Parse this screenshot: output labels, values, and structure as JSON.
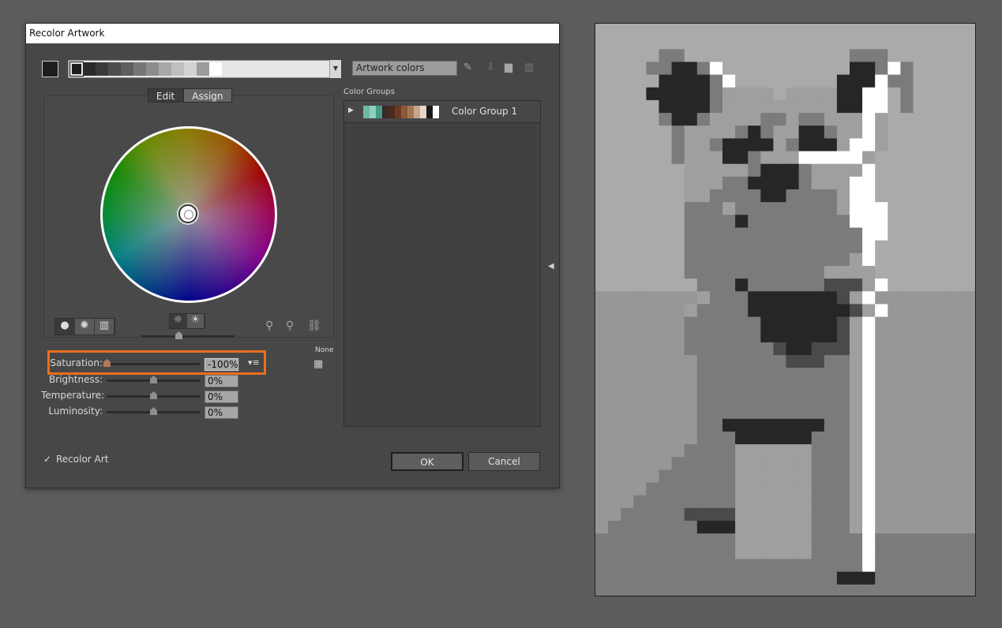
{
  "dialog": {
    "title": "Recolor Artwork",
    "artwork_colors_field": "Artwork colors",
    "strip_colors": [
      "#1e1e1e",
      "#2b2b2b",
      "#3a3a3a",
      "#4d4d4d",
      "#5e5e5e",
      "#767676",
      "#8d8d8d",
      "#a8a8a8",
      "#bfbfbf",
      "#d2d2d2",
      "#9c9c9c",
      "#ffffff"
    ],
    "tabs": [
      {
        "label": "Edit",
        "active": true
      },
      {
        "label": "Assign",
        "active": false
      }
    ],
    "color_groups_label": "Color Groups",
    "group": {
      "name": "Color Group 1",
      "colors": [
        "#6fb8a5",
        "#8ed0bf",
        "#4a9a86",
        "#3a2a24",
        "#4b2a1c",
        "#6b3a22",
        "#8a5a3a",
        "#a27555",
        "#c5a690",
        "#e8d6c8",
        "#1a1a1a",
        "#ffffff"
      ]
    },
    "none_label": "None",
    "sliders": [
      {
        "label": "Saturation:",
        "value": "-100%",
        "level": 0.0
      },
      {
        "label": "Brightness:",
        "value": "0%",
        "level": 0.5
      },
      {
        "label": "Temperature:",
        "value": "0%",
        "level": 0.5
      },
      {
        "label": "Luminosity:",
        "value": "0%",
        "level": 0.5
      }
    ],
    "recolor_art_label": "Recolor Art",
    "recolor_art_checked": true,
    "ok_label": "OK",
    "cancel_label": "Cancel",
    "highlight_color": "#e8701e"
  },
  "preview": {
    "grid_cols": 30,
    "grid_rows": 45,
    "pixels": [
      "ccccccccccccccccccccccccccccccc",
      "cccccccccccccccccccccccccccccc",
      "cccccmmcccccccccccccmmmccccccc",
      "ccccmmDDmWccccccccccDDmWmccccc",
      "cccccDDDDmWccccccccDDDWmmccccc",
      "ccccDDDDDmllllcllllDDWWcmccccc",
      "cccccDDDDmlllllllllDDWWcmccccc",
      "cccccmDDmllllmmlmmlllWlccccccc",
      "ccccccmllllmDmllDDmllWlccccccc",
      "ccccccmllmDDDDlmDDDlWWlccccccc",
      "ccccccmlllDDmlllWWWWWlcccccccc",
      "ccccccclllllmDDDmllllWcccccccc",
      "ccccccclllmmDDDDmlllWWcccccccc",
      "cccccccllmmmmDDmmmmlWWcccccccc",
      "cccccccmmmlmmmmmmmmlWWWccccccc",
      "cccccccmmmmDmmmmmmmmWWWccccccc",
      "cccccccmmmmmmmmmmmmmmWWccccccc",
      "cccccccmmmmmmmmmmmmmmWcccccccc",
      "cccccccmmmmmmmmmmmmmlWcccccccc",
      "cccccccmmmmmmmmmmmllllcccccccc",
      "ccccccccmmmDmmmmmmdddlWccccccc",
      "gggggggglmmmDDDDDDDdlWgggggggg",
      "ggggggglmmmmDDDDDDDDdlWggggggg",
      "gggggggmmmmmmDDDDDDdlWgggggggg",
      "gggggggmmmmmmDDDDDDdlWgggggggg",
      "gggggggmmmmmmmdDDdddlWgggggggg",
      "ggggggggmmmmmmmdddmmlWgggggggg",
      "ggggggggmmmmmmmmmmmmlWgggggggg",
      "ggggggggmmmmmmmmmmmmlWgggggggg",
      "ggggggggmmmmmmmmmmmmlWgggggggg",
      "ggggggggmmmmmmmmmmmmlWgggggggg",
      "ggggggggmmDDDDDDDDmmlWgggggggg",
      "ggggggggmmmDDDDDDmmmlWgggggggg",
      "gggggggmmmmllllllmmmlWgggggggg",
      "ggggggmmmmmllllllmmmlWgggggggg",
      "gggggmmmmmmllllllmmmlWgggggggg",
      "ggggmmmmmmmllllllmmmlWgggggggg",
      "gggmmmmmmmmllllllmmmlWgggggggg",
      "ggmmmmmddddllllllmmmlWgggggggg",
      "gmmmmmmmDDDllllllmmmlWgggggggg",
      "mmmmmmmmmmmllllllmmmmWmmmmmmmm",
      "mmmmmmmmmmmllllllmmmmWmmmmmmmm",
      "mmmmmmmmmmmmmmmmmmmmmWmmmmmmmm",
      "mmmmmmmmmmmmmmmmmmmDDDmmmmmmmm",
      "mmmmmmmmmmmmmmmmmmmmmmmmmmmmmm"
    ],
    "palette": {
      "c": "#aaaaaa",
      "g": "#979797",
      "l": "#9f9f9f",
      "m": "#7b7b7b",
      "d": "#4a4a4a",
      "D": "#262626",
      "W": "#ffffff"
    }
  }
}
